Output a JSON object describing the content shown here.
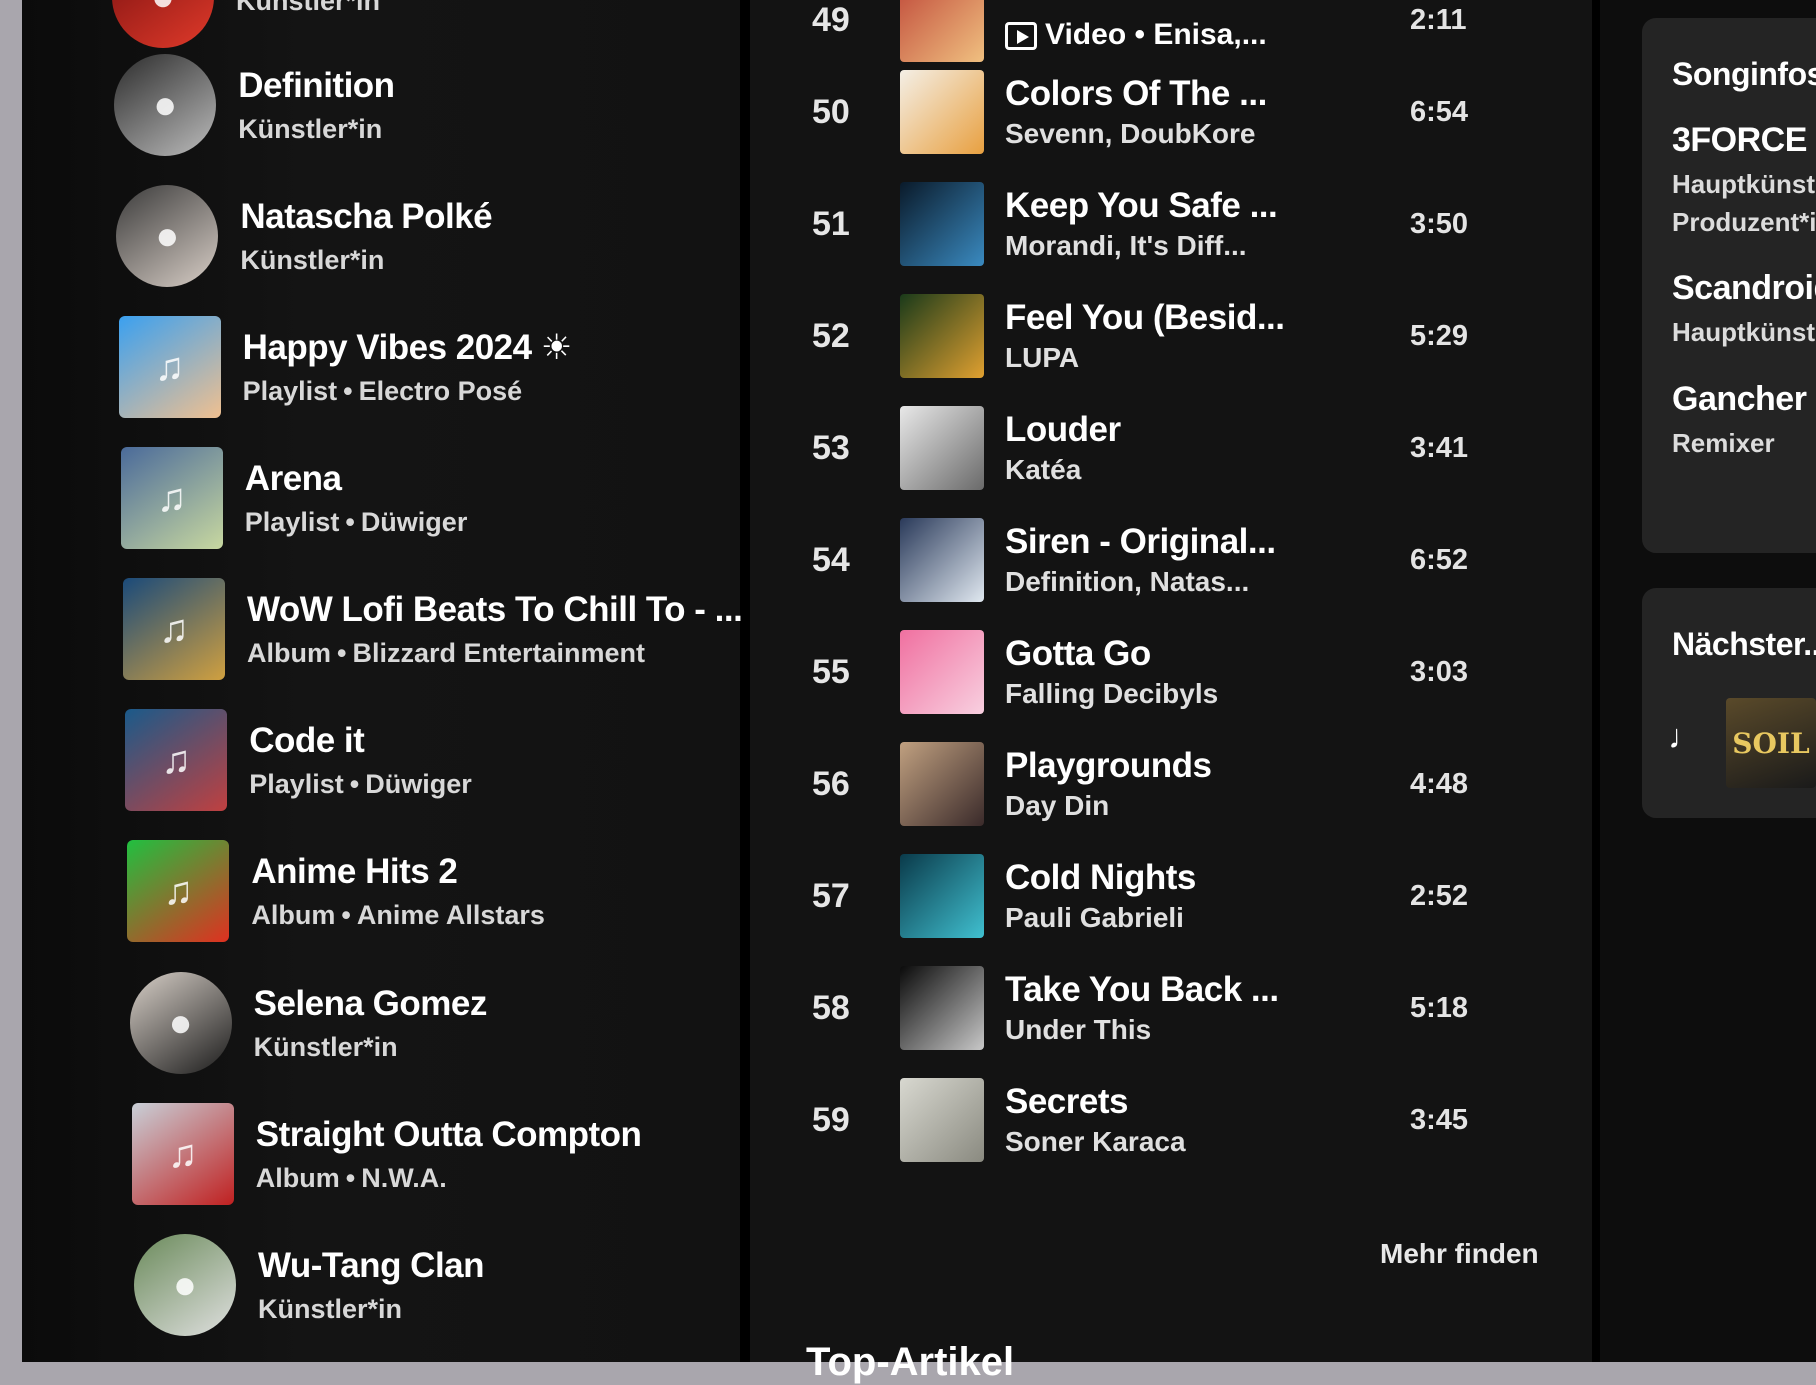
{
  "library": {
    "items": [
      {
        "title": "",
        "subtitle": "Künstler*in",
        "round": true,
        "colors": [
          "#7a1010",
          "#e03a2a"
        ],
        "icon": "person-icon"
      },
      {
        "title": "Definition",
        "subtitle": "Künstler*in",
        "round": true,
        "colors": [
          "#2b2b2b",
          "#bdbdbd"
        ],
        "icon": "person-icon"
      },
      {
        "title": "Natascha Polké",
        "subtitle": "Künstler*in",
        "round": true,
        "colors": [
          "#3a3a3a",
          "#d9cfc7"
        ],
        "icon": "person-icon"
      },
      {
        "title": "Happy Vibes 2024 ☀",
        "subtitle_type": "Playlist",
        "subtitle_owner": "Electro Posé",
        "round": false,
        "colors": [
          "#3aa0f0",
          "#f0c090"
        ],
        "icon": "playlist-icon"
      },
      {
        "title": "Arena",
        "subtitle_type": "Playlist",
        "subtitle_owner": "Düwiger",
        "round": false,
        "colors": [
          "#4a6a9a",
          "#c8d8a0"
        ],
        "icon": "playlist-icon"
      },
      {
        "title": "WoW Lofi Beats To Chill To - ...",
        "subtitle_type": "Album",
        "subtitle_owner": "Blizzard Entertainment",
        "round": false,
        "colors": [
          "#1a4a7a",
          "#d0a040"
        ],
        "icon": "album-icon"
      },
      {
        "title": "Code it",
        "subtitle_type": "Playlist",
        "subtitle_owner": "Düwiger",
        "round": false,
        "colors": [
          "#1a5a8a",
          "#c04040"
        ],
        "icon": "playlist-icon"
      },
      {
        "title": "Anime Hits 2",
        "subtitle_type": "Album",
        "subtitle_owner": "Anime Allstars",
        "round": false,
        "colors": [
          "#20c040",
          "#e03020"
        ],
        "icon": "album-icon"
      },
      {
        "title": "Selena Gomez",
        "subtitle": "Künstler*in",
        "round": true,
        "colors": [
          "#d8d0c8",
          "#1a1a1a"
        ],
        "icon": "person-icon"
      },
      {
        "title": "Straight Outta Compton",
        "subtitle_type": "Album",
        "subtitle_owner": "N.W.A.",
        "round": false,
        "colors": [
          "#c8d0d8",
          "#c02020"
        ],
        "icon": "album-icon"
      },
      {
        "title": "Wu-Tang Clan",
        "subtitle": "Künstler*in",
        "round": true,
        "colors": [
          "#6a8a5a",
          "#e0e0e0"
        ],
        "icon": "person-icon"
      }
    ]
  },
  "tracklist": {
    "partial_row": {
      "number": "49",
      "video_label": "Video",
      "artist": "Enisa,...",
      "duration": "2:11",
      "colors": [
        "#c04a3a",
        "#f0c080"
      ]
    },
    "tracks": [
      {
        "number": "50",
        "title": "Colors Of The ...",
        "artist": "Sevenn, DoubKore",
        "duration": "6:54",
        "colors": [
          "#f4efe6",
          "#e8a040"
        ]
      },
      {
        "number": "51",
        "title": "Keep You Safe ...",
        "artist": "Morandi, It's Diff...",
        "duration": "3:50",
        "colors": [
          "#0a1a2a",
          "#3a8ac0"
        ]
      },
      {
        "number": "52",
        "title": "Feel You (Besid...",
        "artist": "LUPA",
        "duration": "5:29",
        "colors": [
          "#1a3a1a",
          "#e0a030"
        ]
      },
      {
        "number": "53",
        "title": "Louder",
        "artist": "Katéa",
        "duration": "3:41",
        "colors": [
          "#e8e8e8",
          "#6a6a6a"
        ]
      },
      {
        "number": "54",
        "title": "Siren - Original...",
        "artist": "Definition, Natas...",
        "duration": "6:52",
        "colors": [
          "#2a3a5a",
          "#e0e8f0"
        ]
      },
      {
        "number": "55",
        "title": "Gotta Go",
        "artist": "Falling Decibyls",
        "duration": "3:03",
        "colors": [
          "#f070a0",
          "#f8d0e0"
        ]
      },
      {
        "number": "56",
        "title": "Playgrounds",
        "artist": "Day Din",
        "duration": "4:48",
        "colors": [
          "#c0a080",
          "#3a2a2a"
        ]
      },
      {
        "number": "57",
        "title": "Cold Nights",
        "artist": "Pauli Gabrieli",
        "duration": "2:52",
        "colors": [
          "#0a3a4a",
          "#40c0d0"
        ]
      },
      {
        "number": "58",
        "title": "Take You Back ...",
        "artist": "Under This",
        "duration": "5:18",
        "colors": [
          "#0a0a0a",
          "#c8c8c8"
        ]
      },
      {
        "number": "59",
        "title": "Secrets",
        "artist": "Soner Karaca",
        "duration": "3:45",
        "colors": [
          "#d8d8d0",
          "#8a8a80"
        ]
      }
    ],
    "more_label": "Mehr finden",
    "bottom_heading": "Top-Artikel"
  },
  "rightbar": {
    "credits_title": "Songinfos",
    "credits": [
      {
        "name": "3FORCE",
        "roles": [
          "Hauptkünstle",
          "Produzent*in"
        ]
      },
      {
        "name": "Scandroid",
        "roles": [
          "Hauptkünstle"
        ]
      },
      {
        "name": "Gancher & R",
        "roles": [
          "Remixer"
        ]
      }
    ],
    "next_title": "Nächster...",
    "next_icon": "music-note-icon",
    "next_cover_text": "SOIL"
  }
}
